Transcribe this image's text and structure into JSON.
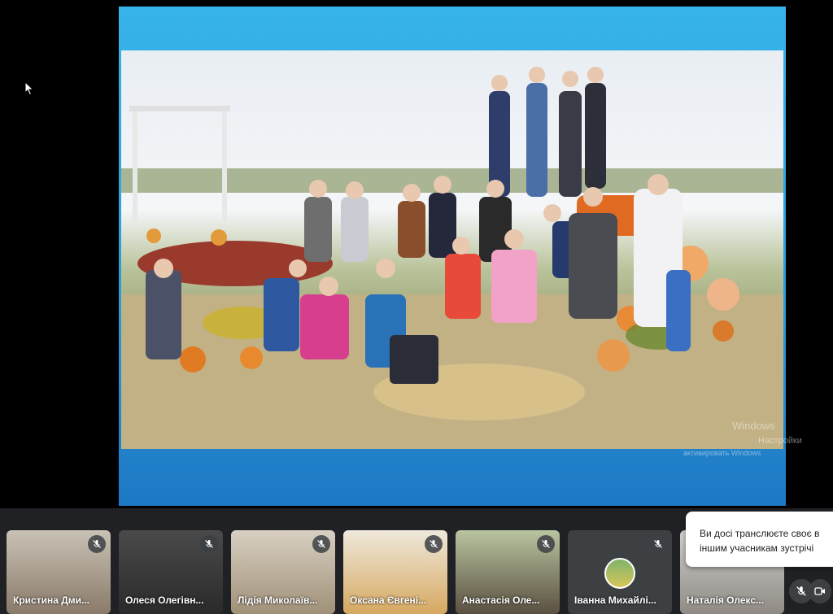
{
  "slide": {
    "watermark_title": "Windows",
    "watermark_line1": "Настройки",
    "watermark_line2": "активировать Windows"
  },
  "participants": [
    {
      "name": "Кристина Дми...",
      "muted": true
    },
    {
      "name": "Олеся Олегівн...",
      "muted": true
    },
    {
      "name": "Лідія Миколаїв...",
      "muted": true
    },
    {
      "name": "Оксана Євгені...",
      "muted": true
    },
    {
      "name": "Анастасія Оле...",
      "muted": true
    },
    {
      "name": "Іванна Михайлі...",
      "muted": true
    },
    {
      "name": "Наталія Олекс...",
      "muted": false
    }
  ],
  "toast": {
    "line1": "Ви досі транслюєте своє в",
    "line2": "іншим учасникам зустрічі"
  },
  "icons": {
    "cursor": "mouse-pointer-icon",
    "mic_off": "mic-off-icon",
    "camera": "camera-icon"
  },
  "colors": {
    "slide_blue": "#2a9ad8",
    "meet_bg": "#202124",
    "tile_bg": "#3c4043"
  }
}
